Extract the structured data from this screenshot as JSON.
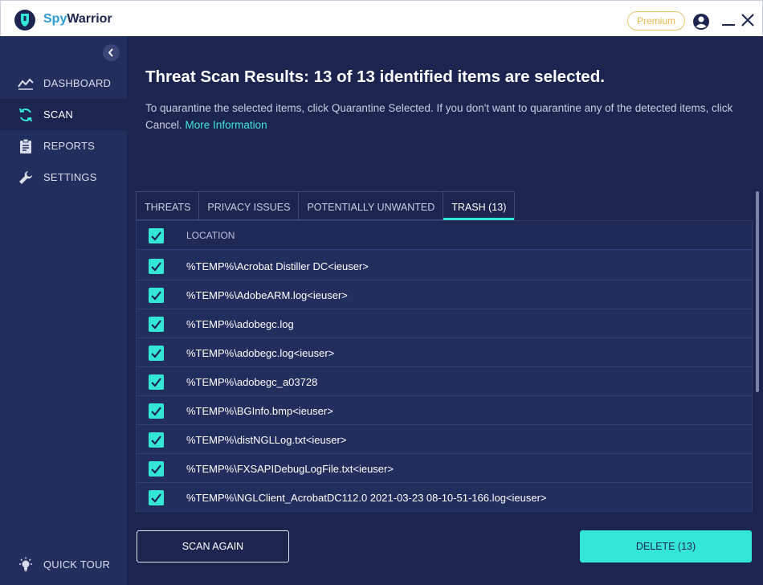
{
  "app": {
    "name_part1": "Spy",
    "name_part2": "Warrior",
    "premium_label": "Premium"
  },
  "colors": {
    "accent": "#34e6d6",
    "background": "#1b2550",
    "sidebar": "#222e5e",
    "premium": "#e6b544"
  },
  "sidebar": {
    "items": [
      {
        "label": "DASHBOARD",
        "icon": "dashboard-chart-icon"
      },
      {
        "label": "SCAN",
        "icon": "refresh-icon",
        "active": true
      },
      {
        "label": "REPORTS",
        "icon": "clipboard-icon"
      },
      {
        "label": "SETTINGS",
        "icon": "wrench-icon"
      }
    ],
    "footer": {
      "label": "QUICK TOUR",
      "icon": "lightbulb-icon"
    }
  },
  "main": {
    "title": "Threat Scan Results: 13 of 13 identified items are selected.",
    "description": "To quarantine the selected items, click Quarantine Selected. If you don't want to quarantine any of the detected items, click Cancel.",
    "more_info": "More Information"
  },
  "tabs": [
    {
      "label": "THREATS"
    },
    {
      "label": "PRIVACY ISSUES"
    },
    {
      "label": "POTENTIALLY UNWANTED"
    },
    {
      "label": "TRASH (13)",
      "active": true
    }
  ],
  "table": {
    "header": "LOCATION",
    "rows": [
      "%TEMP%\\Acrobat Distiller DC<ieuser>",
      "%TEMP%\\AdobeARM.log<ieuser>",
      "%TEMP%\\adobegc.log",
      "%TEMP%\\adobegc.log<ieuser>",
      "%TEMP%\\adobegc_a03728",
      "%TEMP%\\BGInfo.bmp<ieuser>",
      "%TEMP%\\distNGLLog.txt<ieuser>",
      "%TEMP%\\FXSAPIDebugLogFile.txt<ieuser>",
      "%TEMP%\\NGLClient_AcrobatDC112.0 2021-03-23 08-10-51-166.log<ieuser>"
    ]
  },
  "buttons": {
    "scan_again": "SCAN AGAIN",
    "delete": "DELETE (13)"
  }
}
